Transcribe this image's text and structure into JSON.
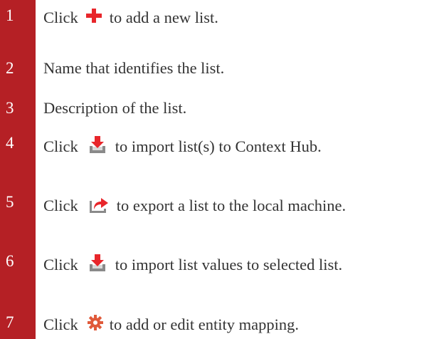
{
  "steps": [
    {
      "num": "1",
      "before": "Click",
      "icon": "add-icon",
      "after": "to add a new list."
    },
    {
      "num": "2",
      "text": "Name that identifies the list."
    },
    {
      "num": "3",
      "text": "Description of the list."
    },
    {
      "num": "4",
      "before": "Click",
      "icon": "import-icon",
      "after": "to import list(s) to Context Hub."
    },
    {
      "num": "5",
      "before": "Click",
      "icon": "export-icon",
      "after": "to export a list to the local machine."
    },
    {
      "num": "6",
      "before": "Click",
      "icon": "import-icon",
      "after": "to import list values to selected list."
    },
    {
      "num": "7",
      "before": "Click",
      "icon": "gear-icon",
      "after": "to add or edit entity mapping."
    }
  ],
  "colors": {
    "rail": "#b52025",
    "add_icon": "#e8262b",
    "import_export_arrow": "#e8262b",
    "tray": "#8a8a8a",
    "gear": "#e05a3a"
  }
}
